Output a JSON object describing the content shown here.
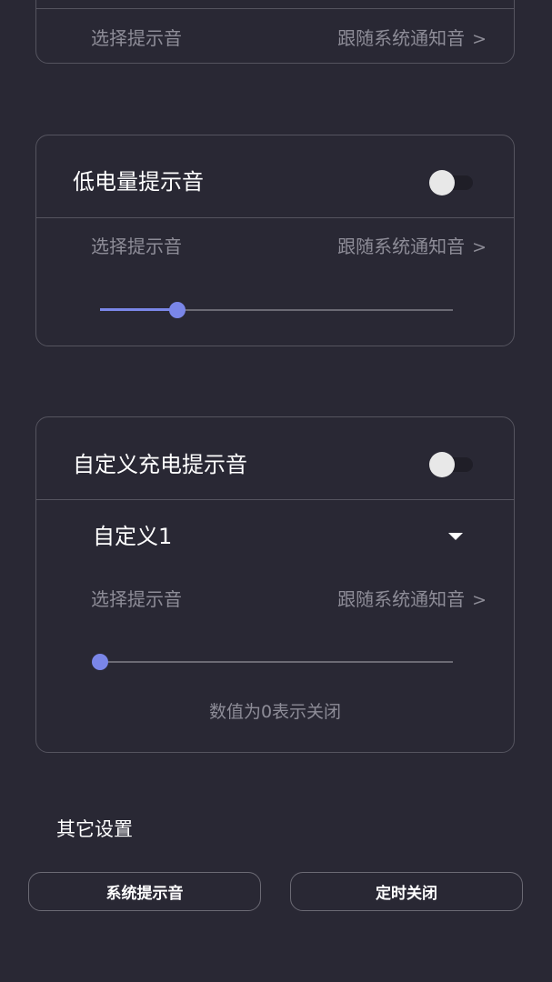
{
  "top_card": {
    "row_label": "选择提示音",
    "row_value": "跟随系统通知音",
    "chevron": ">"
  },
  "low_battery_card": {
    "title": "低电量提示音",
    "toggle_on": false,
    "row_label": "选择提示音",
    "row_value": "跟随系统通知音",
    "chevron": ">",
    "slider_fraction": 0.22
  },
  "custom_card": {
    "title": "自定义充电提示音",
    "toggle_on": false,
    "selected_option": "自定义1",
    "row_label": "选择提示音",
    "row_value": "跟随系统通知音",
    "chevron": ">",
    "slider_fraction": 0.0,
    "hint": "数值为0表示关闭"
  },
  "other_settings": {
    "title": "其它设置",
    "buttons": [
      {
        "label": "系统提示音"
      },
      {
        "label": "定时关闭"
      }
    ]
  },
  "colors": {
    "background": "#292834",
    "accent": "#7a86e8",
    "border": "#55545f",
    "muted_text": "#8d8c97"
  },
  "icons": {
    "chevron": "chevron-right-icon",
    "dropdown": "caret-down-icon"
  }
}
